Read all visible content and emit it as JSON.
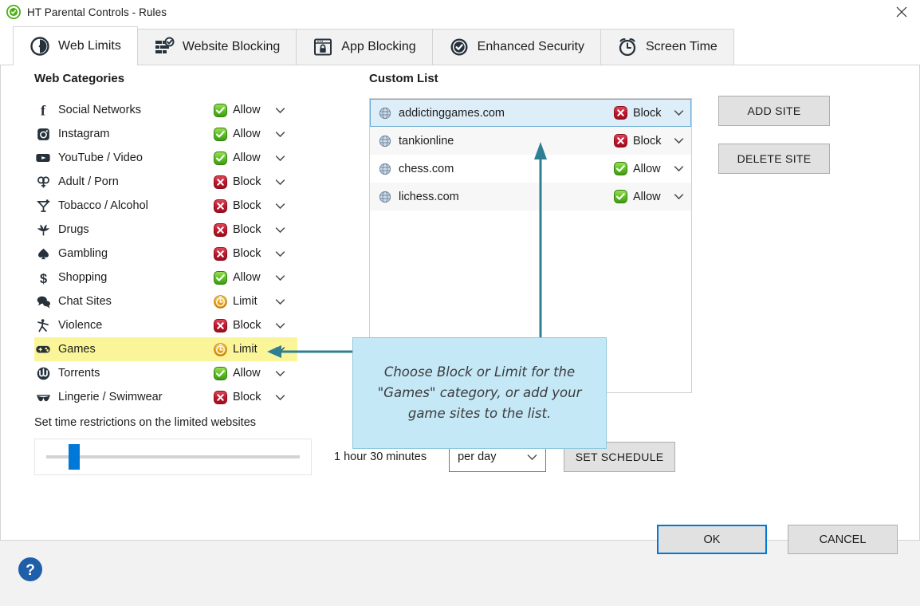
{
  "window": {
    "title": "HT Parental Controls - Rules",
    "logo_icon": "shield-check-icon",
    "close_icon": "close-icon"
  },
  "tabs": [
    {
      "label": "Web Limits",
      "icon": "clock-pie-icon",
      "active": true
    },
    {
      "label": "Website Blocking",
      "icon": "bricks-check-icon",
      "active": false
    },
    {
      "label": "App Blocking",
      "icon": "app-lock-icon",
      "active": false
    },
    {
      "label": "Enhanced Security",
      "icon": "shield-check-icon",
      "active": false
    },
    {
      "label": "Screen Time",
      "icon": "alarm-clock-icon",
      "active": false
    }
  ],
  "web_categories": {
    "title": "Web Categories",
    "items": [
      {
        "name": "Social Networks",
        "icon": "facebook-icon",
        "state": "Allow",
        "state_kind": "allow",
        "highlight": false
      },
      {
        "name": "Instagram",
        "icon": "instagram-icon",
        "state": "Allow",
        "state_kind": "allow",
        "highlight": false
      },
      {
        "name": "YouTube / Video",
        "icon": "youtube-icon",
        "state": "Allow",
        "state_kind": "allow",
        "highlight": false
      },
      {
        "name": "Adult / Porn",
        "icon": "gender-icon",
        "state": "Block",
        "state_kind": "block",
        "highlight": false
      },
      {
        "name": "Tobacco / Alcohol",
        "icon": "cocktail-icon",
        "state": "Block",
        "state_kind": "block",
        "highlight": false
      },
      {
        "name": "Drugs",
        "icon": "cannabis-icon",
        "state": "Block",
        "state_kind": "block",
        "highlight": false
      },
      {
        "name": "Gambling",
        "icon": "spade-icon",
        "state": "Block",
        "state_kind": "block",
        "highlight": false
      },
      {
        "name": "Shopping",
        "icon": "dollar-icon",
        "state": "Allow",
        "state_kind": "allow",
        "highlight": false
      },
      {
        "name": "Chat Sites",
        "icon": "chat-icon",
        "state": "Limit",
        "state_kind": "limit",
        "highlight": false
      },
      {
        "name": "Violence",
        "icon": "fighter-icon",
        "state": "Block",
        "state_kind": "block",
        "highlight": false
      },
      {
        "name": "Games",
        "icon": "gamepad-icon",
        "state": "Limit",
        "state_kind": "limit",
        "highlight": true
      },
      {
        "name": "Torrents",
        "icon": "torrent-icon",
        "state": "Allow",
        "state_kind": "allow",
        "highlight": false
      },
      {
        "name": "Lingerie / Swimwear",
        "icon": "bra-icon",
        "state": "Block",
        "state_kind": "block",
        "highlight": false
      }
    ]
  },
  "custom_list": {
    "title": "Custom List",
    "items": [
      {
        "site": "addictinggames.com",
        "icon": "globe-icon",
        "state": "Block",
        "state_kind": "block",
        "selected": true
      },
      {
        "site": "tankionline",
        "icon": "globe-icon",
        "state": "Block",
        "state_kind": "block",
        "selected": false
      },
      {
        "site": "chess.com",
        "icon": "globe-icon",
        "state": "Allow",
        "state_kind": "allow",
        "selected": false
      },
      {
        "site": "lichess.com",
        "icon": "globe-icon",
        "state": "Allow",
        "state_kind": "allow",
        "selected": false
      }
    ]
  },
  "side_buttons": {
    "add_site": "ADD SITE",
    "delete_site": "DELETE SITE"
  },
  "time_restrictions": {
    "label": "Set time restrictions on the limited websites",
    "duration": "1 hour 30 minutes",
    "period": "per day",
    "period_caret_icon": "chevron-down-icon",
    "set_schedule": "SET SCHEDULE",
    "slider_position_percent": 11
  },
  "callout": {
    "text": "Choose Block or Limit for the \"Games\" category, or add your game sites to the list.",
    "color": "#c5e8f7",
    "arrow_color": "#2e7f94"
  },
  "footer": {
    "help_icon": "help-icon",
    "ok": "OK",
    "cancel": "CANCEL"
  },
  "colors": {
    "allow": "#4caf15",
    "block": "#c0172b",
    "limit": "#e8a317",
    "accent": "#0078d7",
    "highlight_row": "#fbf59a",
    "selected_row": "#ddeef8"
  }
}
